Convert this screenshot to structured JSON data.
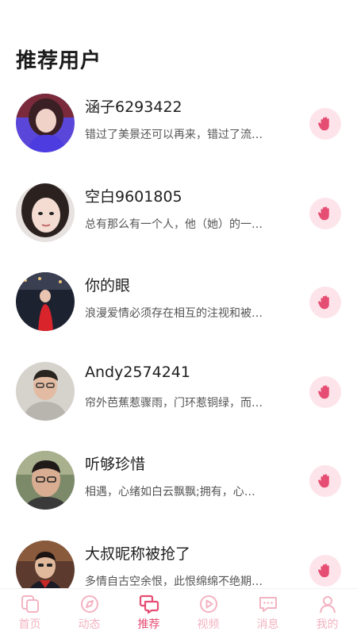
{
  "page": {
    "title": "推荐用户"
  },
  "users": [
    {
      "name": "涵子6293422",
      "signature": "错过了美景还可以再来，错过了流…"
    },
    {
      "name": "空白9601805",
      "signature": "总有那么有一个人，他（她）的一…"
    },
    {
      "name": "你的眼",
      "signature": "浪漫爱情必须存在相互的注视和被…"
    },
    {
      "name": "Andy2574241",
      "signature": "帘外芭蕉惹骤雨，门环惹铜绿，而…"
    },
    {
      "name": "听够珍惜",
      "signature": "相遇，心绪如白云飘飘;拥有，心…"
    },
    {
      "name": "大叔昵称被抢了",
      "signature": "多情自古空余恨，此恨绵绵不绝期…"
    }
  ],
  "tabs": [
    {
      "label": "首页",
      "icon": "home-icon"
    },
    {
      "label": "动态",
      "icon": "compass-icon"
    },
    {
      "label": "推荐",
      "icon": "chat-bubbles-icon",
      "active": true
    },
    {
      "label": "视频",
      "icon": "play-icon"
    },
    {
      "label": "消息",
      "icon": "message-icon"
    },
    {
      "label": "我的",
      "icon": "person-icon"
    }
  ],
  "colors": {
    "accent": "#e64d73",
    "accent_light": "#f3b3c2",
    "greet_bg": "#fde4ea"
  }
}
